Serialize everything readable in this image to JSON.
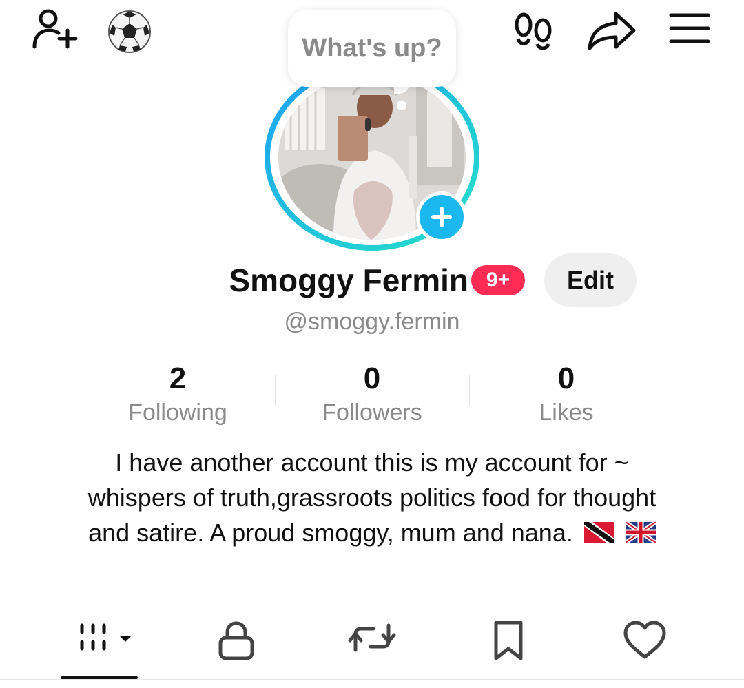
{
  "header": {
    "add_friend_icon": "person-plus-icon",
    "status_icon": "soccer-ball-icon",
    "profile_views_icon": "footprints-icon",
    "share_icon": "share-arrow-icon",
    "menu_icon": "hamburger-menu-icon"
  },
  "note_bubble": {
    "text": "What's up?"
  },
  "profile": {
    "name": "Smoggy Fermin",
    "notification_badge": "9+",
    "edit_label": "Edit",
    "handle": "@smoggy.fermin"
  },
  "stats": [
    {
      "value": "2",
      "label": "Following"
    },
    {
      "value": "0",
      "label": "Followers"
    },
    {
      "value": "0",
      "label": "Likes"
    }
  ],
  "bio": "I have another account this is my account for ~ whispers of truth,grassroots politics food for thought and satire. A proud smoggy, mum and nana.",
  "bio_flags": [
    "flag-trinidad-and-tobago",
    "flag-united-kingdom"
  ],
  "tabs": [
    {
      "icon": "videos-grid-icon",
      "active": true
    },
    {
      "icon": "lock-icon",
      "active": false
    },
    {
      "icon": "repost-icon",
      "active": false
    },
    {
      "icon": "bookmark-icon",
      "active": false
    },
    {
      "icon": "heart-icon",
      "active": false
    }
  ],
  "colors": {
    "badge": "#fe2c55",
    "accent_blue": "#1ab8ef",
    "ring_start": "#1da1f2",
    "ring_end": "#25e0c8",
    "muted_text": "#8a8a8a"
  }
}
